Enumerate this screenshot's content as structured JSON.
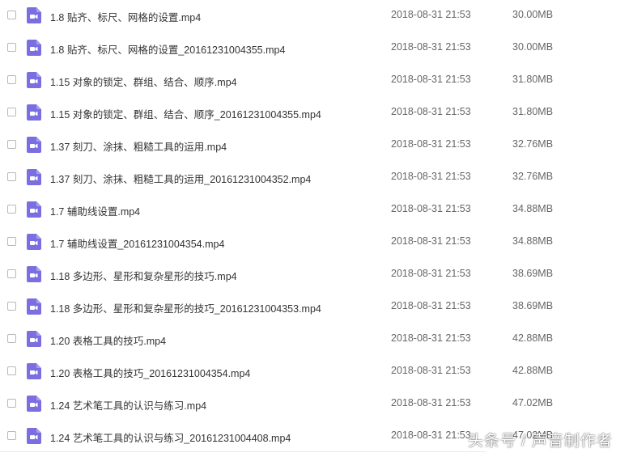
{
  "icon_color": "#7b6ee0",
  "files": [
    {
      "name": "1.8 贴齐、标尺、网格的设置.mp4",
      "date": "2018-08-31 21:53",
      "size": "30.00MB",
      "icon": "video-file-icon"
    },
    {
      "name": "1.8 贴齐、标尺、网格的设置_20161231004355.mp4",
      "date": "2018-08-31 21:53",
      "size": "30.00MB",
      "icon": "video-file-icon"
    },
    {
      "name": "1.15 对象的锁定、群组、结合、顺序.mp4",
      "date": "2018-08-31 21:53",
      "size": "31.80MB",
      "icon": "video-file-icon"
    },
    {
      "name": "1.15 对象的锁定、群组、结合、顺序_20161231004355.mp4",
      "date": "2018-08-31 21:53",
      "size": "31.80MB",
      "icon": "video-file-icon"
    },
    {
      "name": "1.37 刻刀、涂抹、粗糙工具的运用.mp4",
      "date": "2018-08-31 21:53",
      "size": "32.76MB",
      "icon": "video-file-icon"
    },
    {
      "name": "1.37 刻刀、涂抹、粗糙工具的运用_20161231004352.mp4",
      "date": "2018-08-31 21:53",
      "size": "32.76MB",
      "icon": "video-file-icon"
    },
    {
      "name": "1.7 辅助线设置.mp4",
      "date": "2018-08-31 21:53",
      "size": "34.88MB",
      "icon": "video-file-icon"
    },
    {
      "name": "1.7 辅助线设置_20161231004354.mp4",
      "date": "2018-08-31 21:53",
      "size": "34.88MB",
      "icon": "video-file-icon"
    },
    {
      "name": "1.18 多边形、星形和复杂星形的技巧.mp4",
      "date": "2018-08-31 21:53",
      "size": "38.69MB",
      "icon": "video-file-icon"
    },
    {
      "name": "1.18 多边形、星形和复杂星形的技巧_20161231004353.mp4",
      "date": "2018-08-31 21:53",
      "size": "38.69MB",
      "icon": "video-file-icon"
    },
    {
      "name": "1.20 表格工具的技巧.mp4",
      "date": "2018-08-31 21:53",
      "size": "42.88MB",
      "icon": "video-file-icon"
    },
    {
      "name": "1.20 表格工具的技巧_20161231004354.mp4",
      "date": "2018-08-31 21:53",
      "size": "42.88MB",
      "icon": "video-file-icon"
    },
    {
      "name": "1.24 艺术笔工具的认识与练习.mp4",
      "date": "2018-08-31 21:53",
      "size": "47.02MB",
      "icon": "video-file-icon"
    },
    {
      "name": "1.24 艺术笔工具的认识与练习_20161231004408.mp4",
      "date": "2018-08-31 21:53",
      "size": "47.02MB",
      "icon": "video-file-icon"
    }
  ],
  "watermark": "头条号 / 声音制作者"
}
